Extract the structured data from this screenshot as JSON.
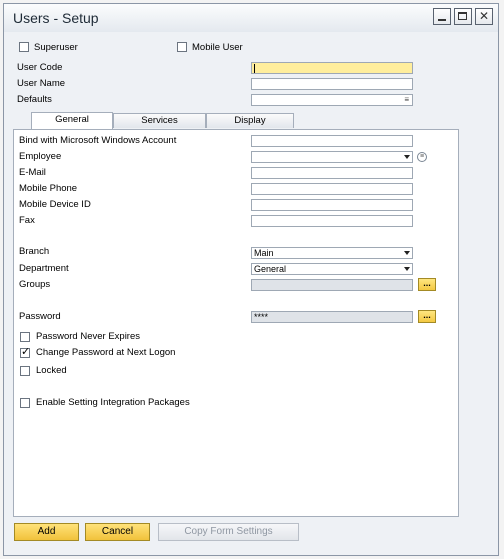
{
  "window": {
    "title": "Users - Setup"
  },
  "header": {
    "superuser_label": "Superuser",
    "superuser_checked": false,
    "mobile_user_label": "Mobile User",
    "mobile_user_checked": false,
    "user_code_label": "User Code",
    "user_code_value": "",
    "user_name_label": "User Name",
    "user_name_value": "",
    "defaults_label": "Defaults",
    "defaults_value": ""
  },
  "tabs": [
    {
      "label": "General",
      "active": true
    },
    {
      "label": "Services",
      "active": false
    },
    {
      "label": "Display",
      "active": false
    }
  ],
  "general": {
    "bind_windows_label": "Bind with Microsoft Windows Account",
    "employee_label": "Employee",
    "email_label": "E-Mail",
    "mobile_phone_label": "Mobile Phone",
    "mobile_device_label": "Mobile Device ID",
    "fax_label": "Fax",
    "branch_label": "Branch",
    "branch_value": "Main",
    "department_label": "Department",
    "department_value": "General",
    "groups_label": "Groups",
    "groups_button": "...",
    "password_label": "Password",
    "password_value": "****",
    "password_button": "...",
    "pw_never_expires_label": "Password Never Expires",
    "pw_never_expires_checked": false,
    "change_pw_label": "Change Password at Next Logon",
    "change_pw_checked": true,
    "locked_label": "Locked",
    "locked_checked": false,
    "integration_label": "Enable Setting Integration Packages",
    "integration_checked": false
  },
  "footer": {
    "add_label": "Add",
    "cancel_label": "Cancel",
    "copy_label": "Copy Form Settings"
  },
  "colors": {
    "accent_button": "#f1c23b",
    "mandatory_field": "#ffee9c"
  }
}
